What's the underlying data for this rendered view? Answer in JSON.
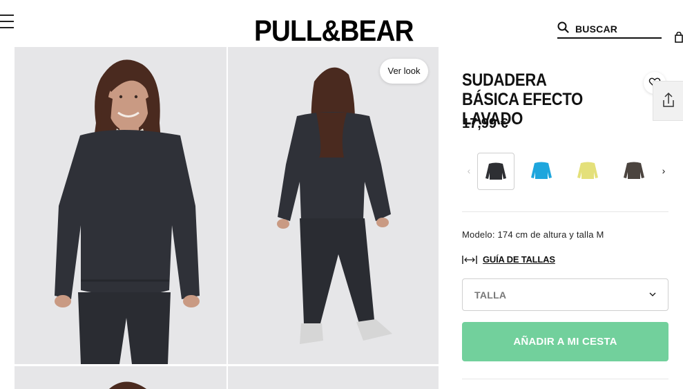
{
  "header": {
    "brand": "PULL&BEAR",
    "search_label": "BUSCAR"
  },
  "gallery": {
    "ver_look_label": "Ver look",
    "photos": [
      {
        "description": "model-front",
        "sweater_color": "#2f3138",
        "skin": "#c99a83",
        "hair": "#4a2a1f"
      },
      {
        "description": "model-back",
        "sweater_color": "#2f3138",
        "skin": "#c99a83",
        "hair": "#4a2a1f"
      }
    ]
  },
  "product": {
    "title": "SUDADERA BÁSICA EFECTO LAVADO",
    "price": "17,99 €",
    "colors": [
      {
        "name": "negro",
        "hex": "#2e2f33",
        "selected": true
      },
      {
        "name": "azul",
        "hex": "#1ea6dd",
        "selected": false
      },
      {
        "name": "amarillo",
        "hex": "#e4e07a",
        "selected": false
      },
      {
        "name": "marron",
        "hex": "#4b443f",
        "selected": false
      }
    ],
    "model_info": "Modelo: 174 cm de altura y talla M",
    "size_guide_label": "GUÍA DE TALLAS",
    "size_select_label": "TALLA",
    "add_to_cart_label": "AÑADIR A MI CESTA"
  },
  "theme": {
    "accent": "#72d09c",
    "photo_bg": "#e6e6e8"
  },
  "icons": [
    "menu-icon",
    "search-icon",
    "bag-icon",
    "heart-icon",
    "share-icon",
    "chevron-left-icon",
    "chevron-right-icon",
    "ruler-icon",
    "chevron-down-icon"
  ]
}
